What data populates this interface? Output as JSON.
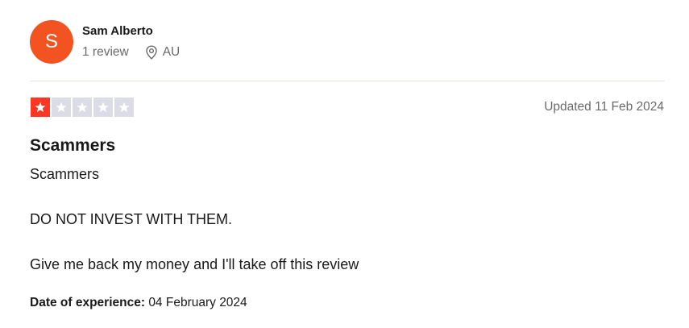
{
  "colors": {
    "avatar_bg": "#f35320",
    "star_filled": "#ff3722",
    "star_empty": "#dcdce6",
    "text_primary": "#191919",
    "text_secondary": "#696a6a"
  },
  "consumer": {
    "avatar_initial": "S",
    "name": "Sam Alberto",
    "review_count": "1 review",
    "location_icon": "location-pin-icon",
    "country": "AU"
  },
  "review": {
    "rating": 1,
    "rating_max": 5,
    "date_updated": "Updated 11 Feb 2024",
    "title": "Scammers",
    "paragraphs": [
      "Scammers",
      "DO NOT INVEST WITH THEM.",
      "Give me back my money and I'll take off this review"
    ],
    "experience_label": "Date of experience:",
    "experience_date": "04 February 2024"
  }
}
